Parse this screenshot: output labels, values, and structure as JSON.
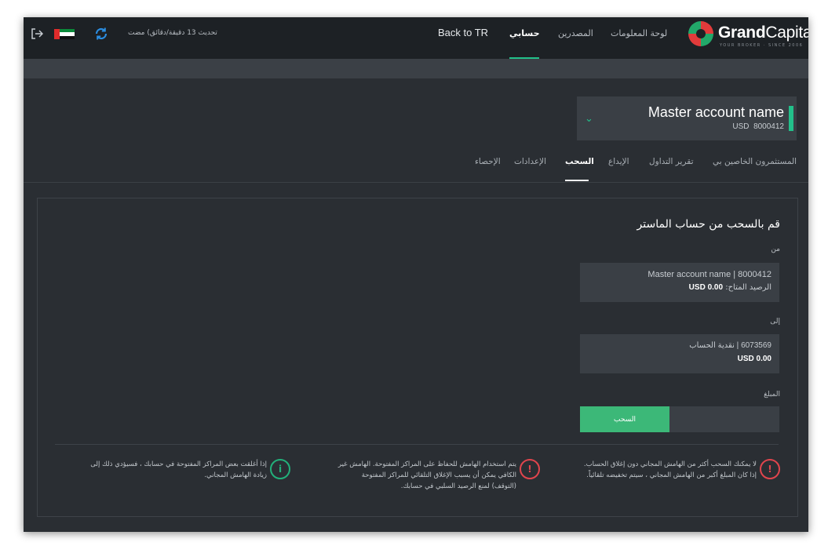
{
  "header": {
    "brand": {
      "bold": "Grand",
      "rest": "Capital",
      "tagline": "YOUR BROKER · SINCE 2006"
    },
    "nav": [
      {
        "label": "لوحة المعلومات",
        "active": false
      },
      {
        "label": "المصدرين",
        "active": false
      },
      {
        "label": "حسابي",
        "active": true
      }
    ],
    "back_label": "Back to TR",
    "update_text": "تحديث 13 دقيقة/دقائق) مضت",
    "icons": [
      "exit-icon",
      "uae-flag-icon",
      "refresh-icon"
    ]
  },
  "account": {
    "name": "Master account name",
    "currency": "USD",
    "number": "8000412"
  },
  "tabs": [
    {
      "label": "المستثمرون الخاصين بي",
      "active": false
    },
    {
      "label": "تقرير التداول",
      "active": false
    },
    {
      "label": "الإيداع",
      "active": false
    },
    {
      "label": "السحب",
      "active": true
    },
    {
      "label": "الإعدادات",
      "active": false
    },
    {
      "label": "الإحصاء",
      "active": false
    }
  ],
  "withdraw": {
    "title": "قم بالسحب من حساب الماستر",
    "from_label": "من",
    "from_line1": "Master account name | 8000412",
    "from_balance_label": "الرصيد المتاح:",
    "from_balance": "USD 0.00",
    "to_label": "إلى",
    "to_line1": "6073569 | نقدية الحساب",
    "to_balance": "USD 0.00",
    "amount_label": "المبلغ",
    "button_label": "السحب"
  },
  "notes": [
    {
      "type": "warning",
      "line1": "لا يمكنك السحب أكثر من الهامش المجاني دون إغلاق الحساب.",
      "line2": "إذا كان المبلغ أكبر من الهامش المجاني ، سيتم تخفيضه تلقائياً.",
      "line3": ""
    },
    {
      "type": "warning",
      "line1": "يتم استخدام الهامش للحفاظ على المراكز المفتوحة. الهامش غير",
      "line2": "الكافي يمكن أن يسبب الإغلاق التلقائي للمراكز المفتوحة",
      "line3": "(التوقف) لمنع الرصيد السلبي في حسابك."
    },
    {
      "type": "info",
      "line1": "إذا أغلقت بعض المراكز المفتوحة في حسابك ، فسيؤدي ذلك إلى",
      "line2": "زيادة الهامش المجاني.",
      "line3": ""
    }
  ],
  "colors": {
    "accent": "#22c08a",
    "button": "#3cb878",
    "danger": "#e0454d",
    "info": "#22b07a",
    "bg": "#2a2e33",
    "topbar": "#1d2125"
  }
}
